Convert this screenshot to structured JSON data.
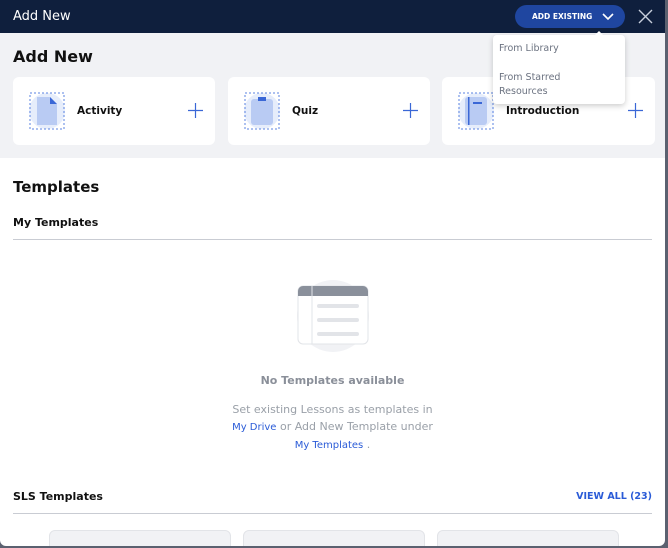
{
  "header": {
    "title": "Add New",
    "add_existing": "ADD EXISTING"
  },
  "dropdown": {
    "items": [
      "From Library",
      "From Starred",
      "Resources"
    ]
  },
  "add_new": {
    "title": "Add New",
    "cards": [
      {
        "label": "Activity",
        "icon": "activity-document-icon"
      },
      {
        "label": "Quiz",
        "icon": "quiz-clipboard-icon"
      },
      {
        "label": "Introduction",
        "icon": "introduction-book-icon"
      }
    ]
  },
  "templates": {
    "title": "Templates",
    "my_templates": "My Templates",
    "empty_title": "No Templates available",
    "empty_line1": "Set existing Lessons as templates in",
    "link_drive": "My Drive",
    "empty_line2": " or Add New Template under",
    "link_templates": "My Templates",
    "period": " .",
    "sls": "SLS Templates",
    "view_all": "VIEW ALL (23)"
  },
  "colors": {
    "header": "#0f1f3d",
    "accent": "#1f46a0",
    "link": "#2a5bd7"
  }
}
